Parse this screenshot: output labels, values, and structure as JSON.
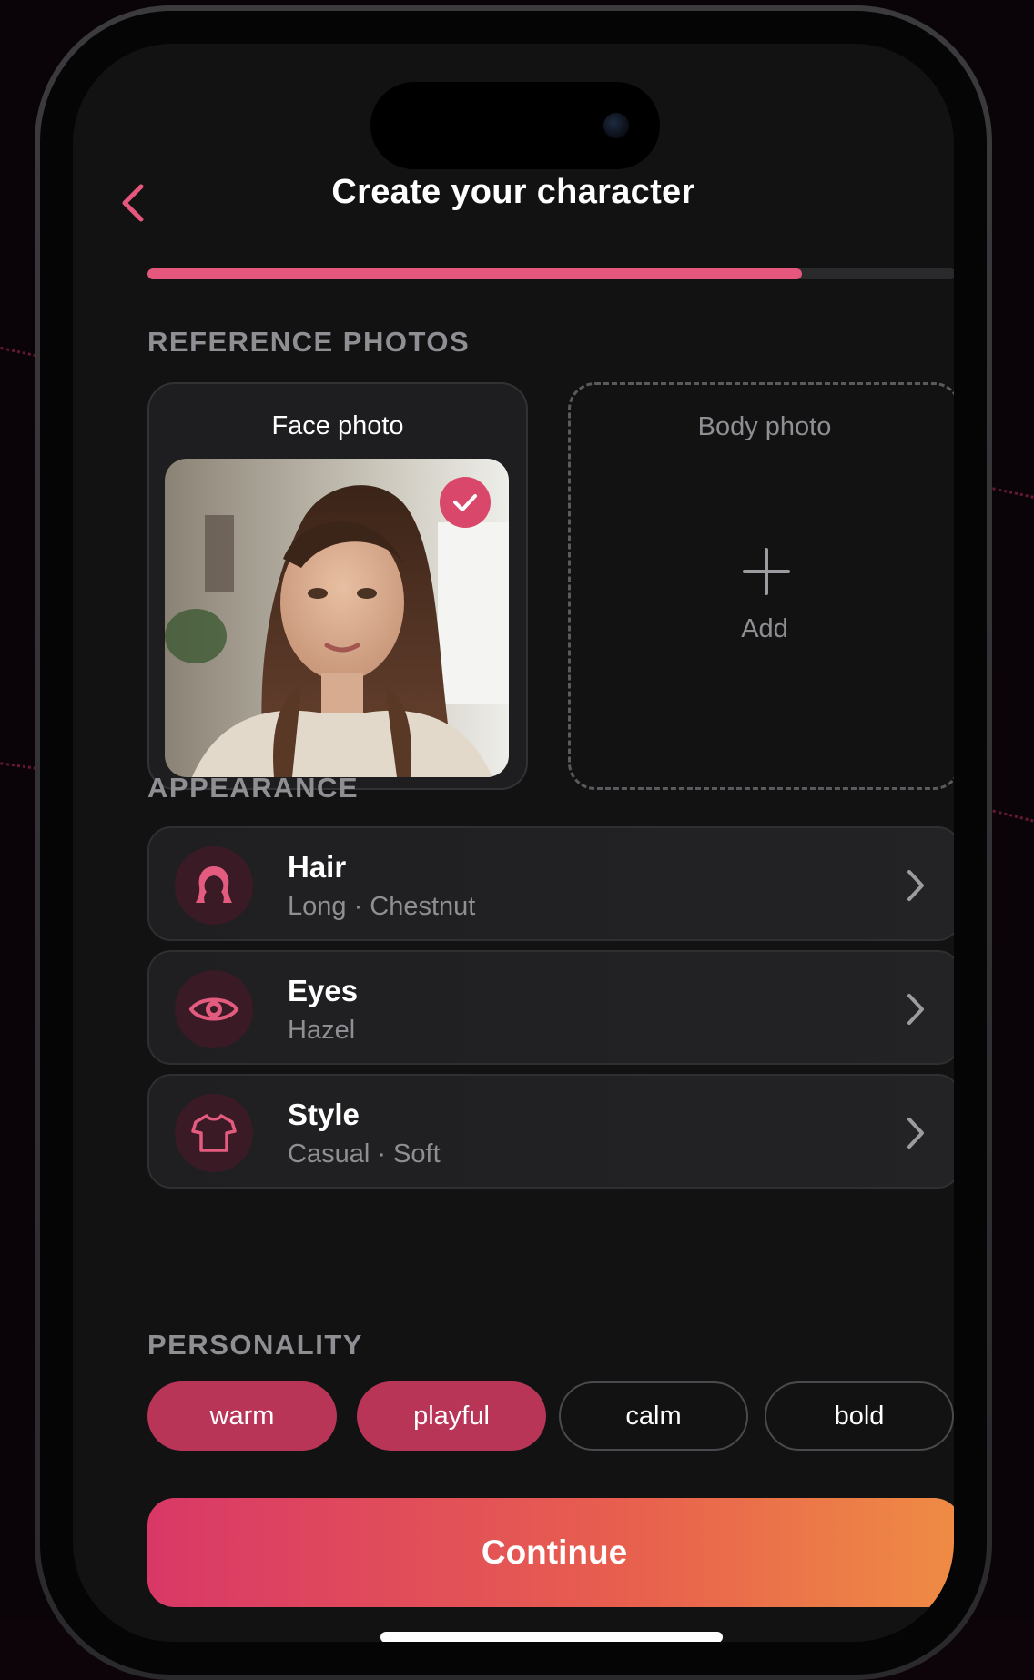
{
  "header": {
    "title": "Create your character",
    "progress": 0.81
  },
  "reference_photos": {
    "label": "REFERENCE PHOTOS",
    "face": {
      "title": "Face photo",
      "selected": true
    },
    "body": {
      "title": "Body photo",
      "add_label": "Add"
    }
  },
  "appearance": {
    "label": "APPEARANCE",
    "items": [
      {
        "title": "Hair",
        "value": "Long · Chestnut",
        "icon": "hair-icon"
      },
      {
        "title": "Eyes",
        "value": "Hazel",
        "icon": "eye-icon"
      },
      {
        "title": "Style",
        "value": "Casual · Soft",
        "icon": "shirt-icon"
      }
    ]
  },
  "personality": {
    "label": "PERSONALITY",
    "chips": [
      {
        "label": "warm",
        "selected": true
      },
      {
        "label": "playful",
        "selected": true
      },
      {
        "label": "calm",
        "selected": false
      },
      {
        "label": "bold",
        "selected": false
      }
    ]
  },
  "continue_label": "Continue",
  "colors": {
    "accent": "#e6577d",
    "chip_selected": "#b83558",
    "button_gradient_start": "#d93867",
    "button_gradient_end": "#ef8c44"
  }
}
